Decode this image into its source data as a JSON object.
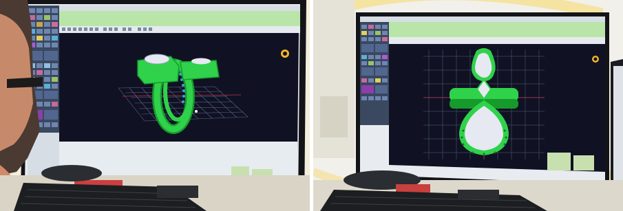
{
  "scene": {
    "description_free": true,
    "panels": [
      {
        "id": "left",
        "view": "perspective"
      },
      {
        "id": "right",
        "view": "front"
      }
    ]
  },
  "colors": {
    "viewport_bg": "#101223",
    "ring_green": "#2fd24a",
    "ring_green_dark": "#169a2c",
    "toolbar_green": "#b9e6a8",
    "gem_white": "#e6e9f2",
    "grid_line": "#6d7ca0",
    "grid_red": "#c0324b",
    "panel_bg": "#3a4860",
    "watermark_yellow": "#f4c431"
  },
  "icons": [
    "monitor-icon",
    "keyboard-icon",
    "mouse-icon",
    "cad-logo-icon"
  ]
}
